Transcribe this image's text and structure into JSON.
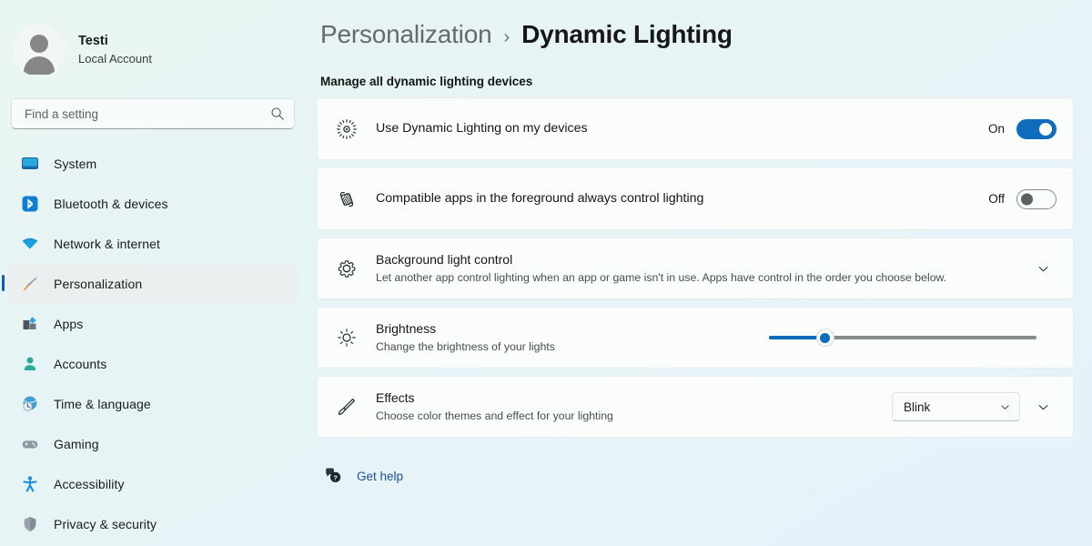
{
  "account": {
    "name": "Testi",
    "type": "Local Account",
    "avatar_icon": "person-avatar-icon"
  },
  "search": {
    "placeholder": "Find a setting",
    "value": "",
    "icon": "search-icon"
  },
  "sidebar": {
    "items": [
      {
        "label": "System",
        "icon": "monitor-icon",
        "selected": false
      },
      {
        "label": "Bluetooth & devices",
        "icon": "bluetooth-icon",
        "selected": false
      },
      {
        "label": "Network & internet",
        "icon": "wifi-icon",
        "selected": false
      },
      {
        "label": "Personalization",
        "icon": "paintbrush-icon",
        "selected": true
      },
      {
        "label": "Apps",
        "icon": "apps-icon",
        "selected": false
      },
      {
        "label": "Accounts",
        "icon": "person-icon",
        "selected": false
      },
      {
        "label": "Time & language",
        "icon": "clock-globe-icon",
        "selected": false
      },
      {
        "label": "Gaming",
        "icon": "gamepad-icon",
        "selected": false
      },
      {
        "label": "Accessibility",
        "icon": "accessibility-icon",
        "selected": false
      },
      {
        "label": "Privacy & security",
        "icon": "shield-icon",
        "selected": false
      }
    ]
  },
  "header": {
    "breadcrumb_parent": "Personalization",
    "breadcrumb_separator": "›",
    "breadcrumb_current": "Dynamic Lighting",
    "section_title": "Manage all dynamic lighting devices"
  },
  "settings": {
    "use_dynamic_lighting": {
      "title": "Use Dynamic Lighting on my devices",
      "icon": "light-burst-icon",
      "toggle_state": "On",
      "toggle_on": true
    },
    "foreground_control": {
      "title": "Compatible apps in the foreground always control lighting",
      "icon": "app-layers-icon",
      "toggle_state": "Off",
      "toggle_on": false
    },
    "background_light_control": {
      "title": "Background light control",
      "description": "Let another app control lighting when an app or game isn't in use. Apps have control in the order you choose below.",
      "icon": "gear-icon",
      "expander_icon": "chevron-down-icon"
    },
    "brightness": {
      "title": "Brightness",
      "description": "Change the brightness of your lights",
      "icon": "sun-icon",
      "value_percent": 21
    },
    "effects": {
      "title": "Effects",
      "description": "Choose color themes and effect for your lighting",
      "icon": "paintbrush-outline-icon",
      "selected_option": "Blink",
      "dropdown_icon": "chevron-down-icon",
      "expander_icon": "chevron-down-icon"
    }
  },
  "footer": {
    "get_help_label": "Get help",
    "get_help_icon": "help-bubble-icon"
  },
  "colors": {
    "accent": "#0f6cbd",
    "background_start": "#e8f5f2",
    "background_end": "#e6f2fa",
    "card": "#fbfdfd",
    "link": "#1f4e93"
  }
}
